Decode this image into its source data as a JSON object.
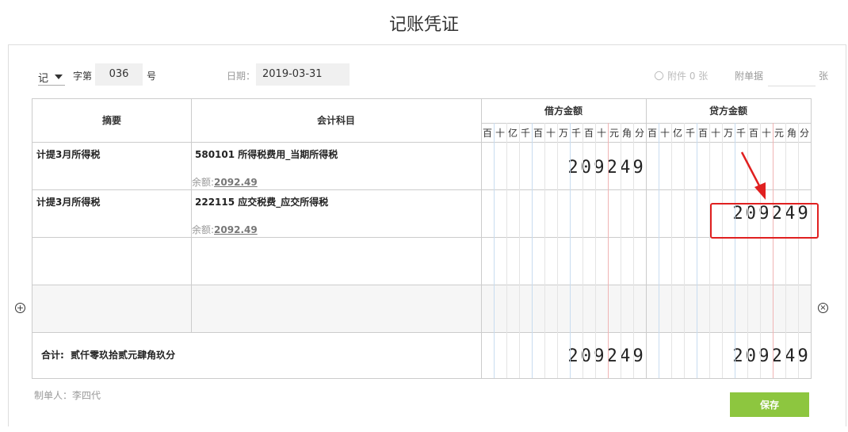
{
  "page": {
    "title": "记账凭证"
  },
  "header": {
    "voucher_type": "记",
    "char_label": "字第",
    "number": "036",
    "number_suffix": "号",
    "date_label": "日期：",
    "date_value": "2019-03-31",
    "attachment_text": "附件 0 张",
    "attached_docs_label": "附单据",
    "attached_docs_value": "",
    "attached_docs_suffix": "张"
  },
  "table": {
    "col_summary": "摘要",
    "col_account": "会计科目",
    "col_debit": "借方金额",
    "col_credit": "贷方金额",
    "digit_units": [
      "百",
      "十",
      "亿",
      "千",
      "百",
      "十",
      "万",
      "千",
      "百",
      "十",
      "元",
      "角",
      "分"
    ],
    "rows": [
      {
        "summary": "计提3月所得税",
        "account": "580101 所得税费用_当期所得税",
        "balance_label": "余额:",
        "balance": "2092.49",
        "debit": "209249",
        "credit": ""
      },
      {
        "summary": "计提3月所得税",
        "account": "222115 应交税费_应交所得税",
        "balance_label": "余额:",
        "balance": "2092.49",
        "debit": "",
        "credit": "209249"
      },
      {
        "summary": "",
        "account": "",
        "balance_label": "",
        "balance": "",
        "debit": "",
        "credit": ""
      },
      {
        "summary": "",
        "account": "",
        "balance_label": "",
        "balance": "",
        "debit": "",
        "credit": ""
      }
    ],
    "total_label": "合计:",
    "total_text": "贰仟零玖拾贰元肆角玖分",
    "total_debit": "209249",
    "total_credit": "209249"
  },
  "icons": {
    "add_row": "plus-circle-icon",
    "delete_row": "close-circle-icon",
    "attachment": "paperclip-icon"
  },
  "footer": {
    "maker_label": "制单人：李四代",
    "save_label": "保存"
  },
  "colors": {
    "save_button": "#8dc63f",
    "annotation": "#e02020",
    "unit_line_blue": "#c8dcf0",
    "unit_line_red": "#f0b4b4"
  }
}
